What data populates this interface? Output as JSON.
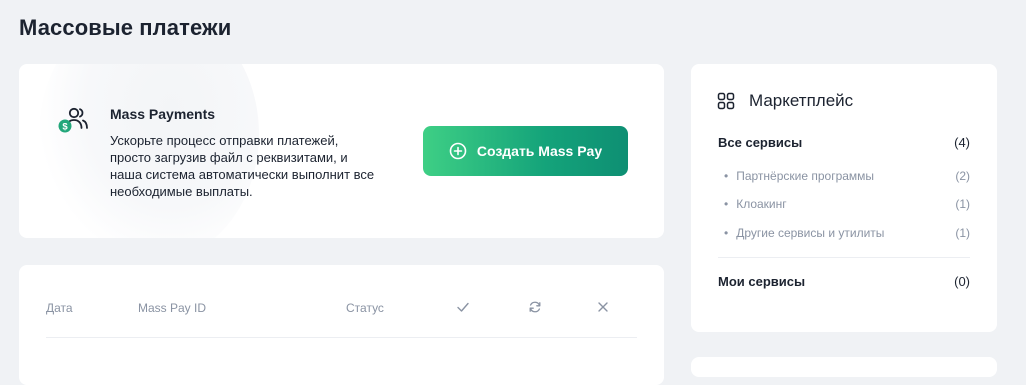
{
  "page": {
    "title": "Массовые платежи"
  },
  "promo": {
    "title": "Mass Payments",
    "description": "Ускорьте процесс отправки платежей, просто загрузив файл с реквизитами, и наша система автоматически выполнит все необходимые выплаты.",
    "button_label": "Создать Mass Pay",
    "icon": "users-dollar-icon",
    "accent_colors": [
      "#3ecf85",
      "#0e8f73"
    ]
  },
  "table": {
    "columns": [
      "Дата",
      "Mass Pay ID",
      "Статус"
    ],
    "status_icons": [
      "check-icon",
      "refresh-icon",
      "close-icon"
    ]
  },
  "marketplace": {
    "title": "Маркетплейс",
    "all_services": {
      "label": "Все сервисы",
      "count": "(4)"
    },
    "categories": [
      {
        "label": "Партнёрские программы",
        "count": "(2)"
      },
      {
        "label": "Клоакинг",
        "count": "(1)"
      },
      {
        "label": "Другие сервисы и утилиты",
        "count": "(1)"
      }
    ],
    "my_services": {
      "label": "Мои сервисы",
      "count": "(0)"
    }
  }
}
